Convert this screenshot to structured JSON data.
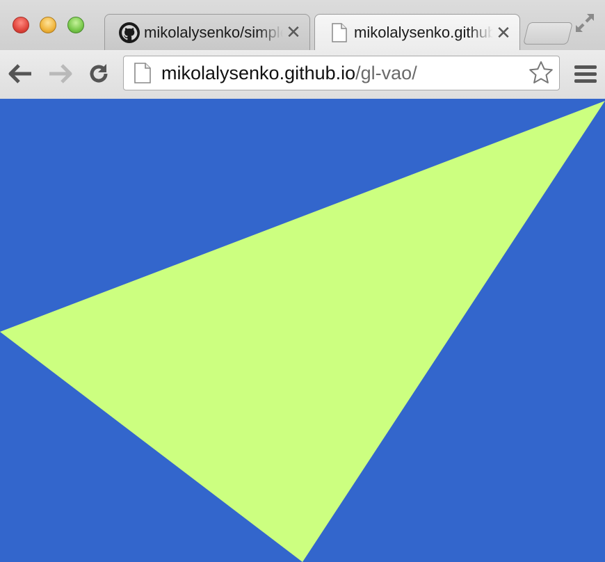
{
  "window": {
    "controls": [
      "close",
      "minimize",
      "zoom"
    ]
  },
  "tabs": [
    {
      "title": "mikolalysenko/simple-",
      "icon": "github-icon",
      "active": false
    },
    {
      "title": "mikolalysenko.github.io/gl-vao/",
      "icon": "page-icon",
      "active": true
    }
  ],
  "toolbar": {
    "back_icon": "back-arrow-icon",
    "forward_icon": "forward-arrow-icon",
    "reload_icon": "reload-icon",
    "url_host": "mikolalysenko.github.io",
    "url_path": "/gl-vao/",
    "bookmark_icon": "star-icon",
    "menu_icon": "hamburger-menu-icon"
  },
  "content": {
    "background_color": "#3366cc",
    "triangle_color": "#ccff80"
  }
}
